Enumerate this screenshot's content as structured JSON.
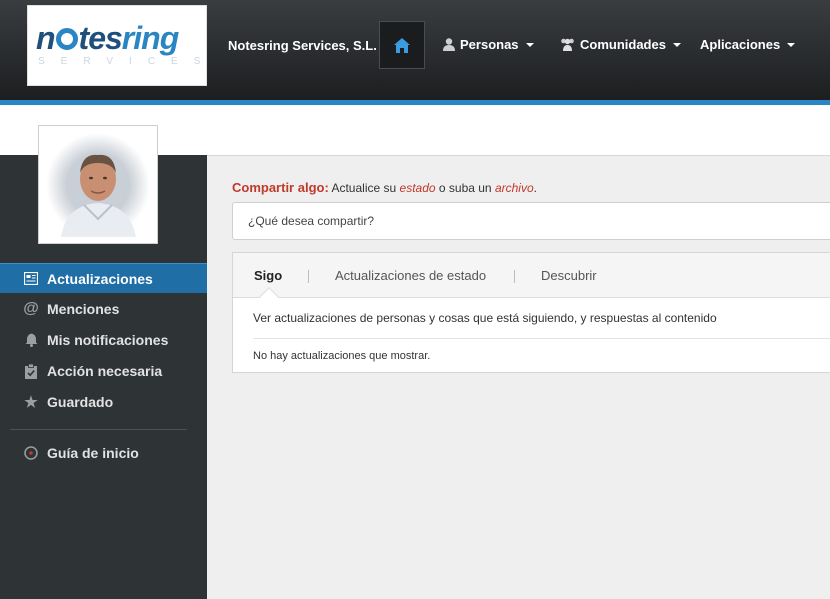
{
  "header": {
    "logo_text_a": "n",
    "logo_text_b": "tes",
    "logo_text_c": "ring",
    "logo_sub": "SERVICES",
    "company": "Notesring Services, S.L.",
    "nav": [
      {
        "label": "Personas",
        "icon": "person-icon"
      },
      {
        "label": "Comunidades",
        "icon": "community-icon"
      },
      {
        "label": "Aplicaciones",
        "icon": ""
      }
    ],
    "accent_color": "#2a86c2"
  },
  "sidebar": {
    "items": [
      {
        "label": "Actualizaciones",
        "icon": "updates-icon",
        "active": true
      },
      {
        "label": "Menciones",
        "icon": "at-icon"
      },
      {
        "label": "Mis notificaciones",
        "icon": "bell-icon"
      },
      {
        "label": "Acción necesaria",
        "icon": "clipboard-check-icon"
      },
      {
        "label": "Guardado",
        "icon": "star-icon"
      },
      {
        "label": "Guía de inicio",
        "icon": "compass-icon"
      }
    ]
  },
  "share": {
    "lead": "Compartir algo:",
    "text_a": " Actualice su ",
    "link_status": "estado",
    "text_b": " o suba un ",
    "link_file": "archivo",
    "text_c": ".",
    "placeholder": "¿Qué desea compartir?"
  },
  "feed": {
    "tabs": [
      "Sigo",
      "Actualizaciones de estado",
      "Descubrir"
    ],
    "description": "Ver actualizaciones de personas y cosas que está siguiendo, y respuestas al contenido",
    "empty": "No hay actualizaciones que mostrar."
  }
}
